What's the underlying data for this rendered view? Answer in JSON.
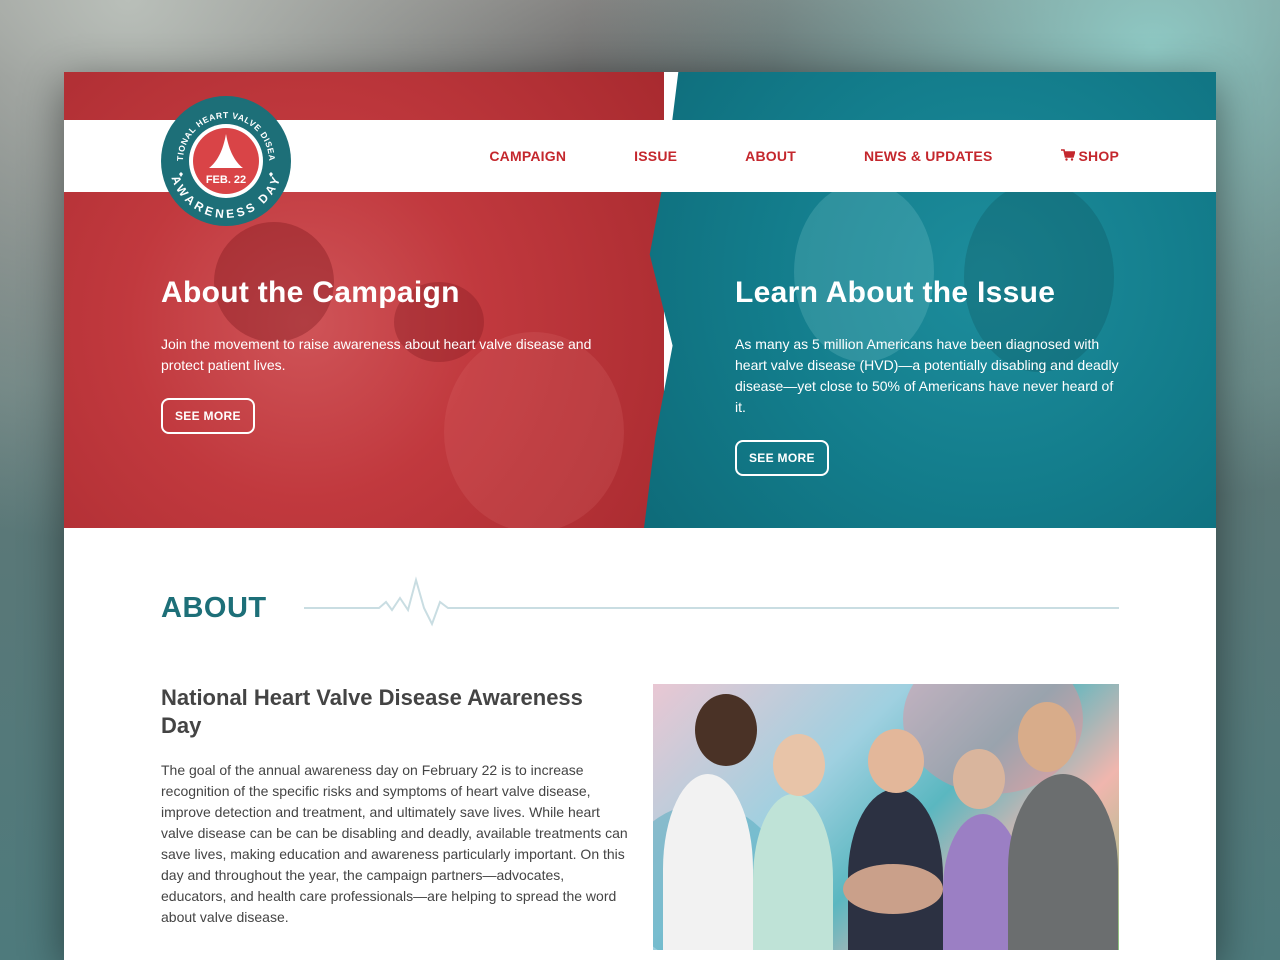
{
  "logo": {
    "ring_top": "NATIONAL HEART VALVE DISEASE",
    "ring_bottom": "AWARENESS DAY",
    "date": "FEB. 22"
  },
  "nav": {
    "items": [
      "CAMPAIGN",
      "ISSUE",
      "ABOUT",
      "NEWS & UPDATES",
      "SHOP"
    ],
    "shop_icon": "cart-icon"
  },
  "hero": {
    "left": {
      "title": "About the Campaign",
      "body": "Join the movement to raise awareness about heart valve disease and protect patient lives.",
      "button": "SEE MORE"
    },
    "right": {
      "title": "Learn About the Issue",
      "body": "As many as 5 million Americans have been diagnosed with heart valve disease (HVD)—a potentially disabling and deadly disease—yet close to 50% of Americans have never heard of it.",
      "button": "SEE MORE"
    }
  },
  "about": {
    "heading": "ABOUT",
    "title": "National Heart Valve Disease Awareness Day",
    "body": "The goal of the annual awareness day on February 22 is to increase recognition of the specific risks and symptoms of heart valve disease, improve detection and treatment, and ultimately save lives. While heart valve disease can be can be disabling and deadly, available treatments can save lives, making education and awareness particularly important. On this day and throughout the year, the campaign partners—advocates, educators, and health care professionals—are helping to spread the word about valve disease."
  },
  "colors": {
    "red": "#c1393e",
    "teal": "#137d8c",
    "heading_teal": "#1d6f78",
    "nav_red": "#c4272d",
    "text": "#444444"
  }
}
